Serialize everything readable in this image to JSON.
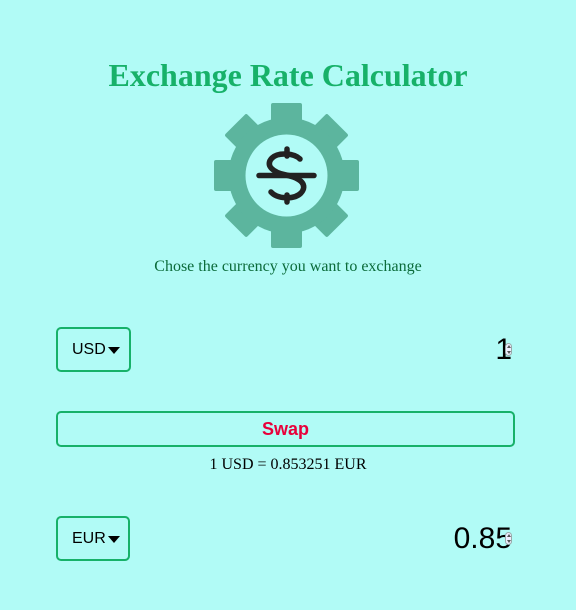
{
  "page": {
    "title": "Exchange Rate Calculator",
    "subtitle": "Chose the currency you want to exchange",
    "logo_icon": "gear-dollar-icon"
  },
  "colors": {
    "background": "#b1fbf6",
    "accent": "#17b169",
    "swap_text": "#e8003a",
    "gear": "#5cb59e"
  },
  "currency_one": {
    "selected": "USD",
    "amount": "1"
  },
  "currency_two": {
    "selected": "EUR",
    "amount": "0.85"
  },
  "swap": {
    "label": "Swap"
  },
  "rate": {
    "text": "1 USD = 0.853251 EUR"
  }
}
